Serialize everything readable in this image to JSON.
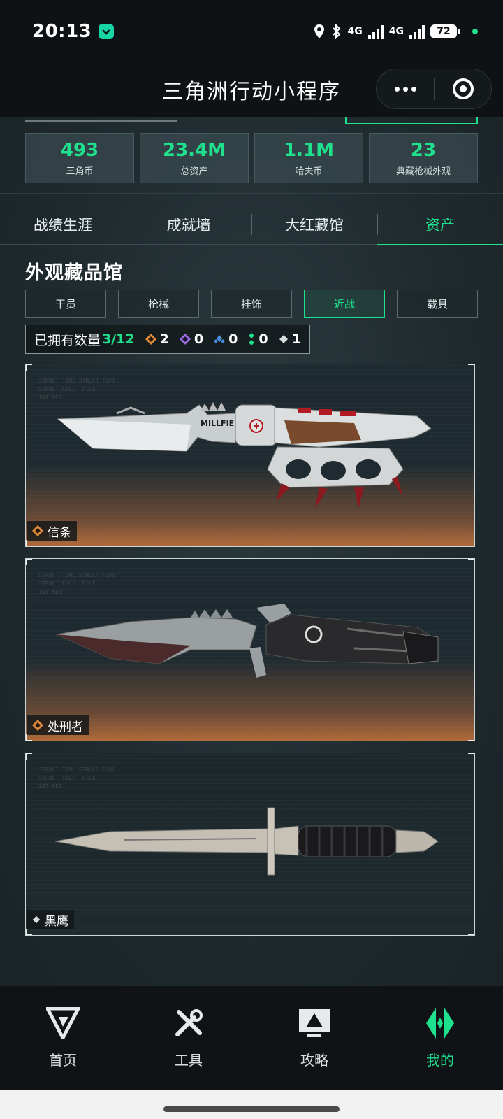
{
  "status_bar": {
    "time": "20:13",
    "network": "4G",
    "battery": "72"
  },
  "header": {
    "title": "三角洲行动小程序"
  },
  "stats": [
    {
      "value": "493",
      "label": "三角币"
    },
    {
      "value": "23.4M",
      "label": "总资产"
    },
    {
      "value": "1.1M",
      "label": "哈夫币"
    },
    {
      "value": "23",
      "label": "典藏枪械外观"
    }
  ],
  "tabs": [
    {
      "label": "战绩生涯",
      "active": false
    },
    {
      "label": "成就墙",
      "active": false
    },
    {
      "label": "大红藏馆",
      "active": false
    },
    {
      "label": "资产",
      "active": true
    }
  ],
  "section_title": "外观藏品馆",
  "categories": [
    {
      "label": "干员",
      "active": false
    },
    {
      "label": "枪械",
      "active": false
    },
    {
      "label": "挂饰",
      "active": false
    },
    {
      "label": "近战",
      "active": true
    },
    {
      "label": "载具",
      "active": false
    }
  ],
  "owned": {
    "label": "已拥有数量",
    "count": "3/12",
    "rarities": [
      {
        "color": "#e08a3c",
        "count": "2"
      },
      {
        "color": "#9a6ee0",
        "count": "0"
      },
      {
        "color": "#4a8ee0",
        "count": "0"
      },
      {
        "color": "#1ee08d",
        "count": "0"
      },
      {
        "color": "#d8dcdd",
        "count": "1"
      }
    ]
  },
  "items": [
    {
      "name": "信条",
      "rarity_color": "#e08a3c",
      "blade_mark": "MILLFIELD"
    },
    {
      "name": "处刑者",
      "rarity_color": "#e08a3c"
    },
    {
      "name": "黑鹰",
      "rarity_color": "#d8dcdd"
    }
  ],
  "tabbar": [
    {
      "label": "首页",
      "icon": "home-logo-icon",
      "active": false
    },
    {
      "label": "工具",
      "icon": "tools-icon",
      "active": false
    },
    {
      "label": "攻略",
      "icon": "guide-icon",
      "active": false
    },
    {
      "label": "我的",
      "icon": "profile-logo-icon",
      "active": true
    }
  ],
  "colors": {
    "accent": "#1ee08d",
    "gold": "#e08a3c",
    "background": "#1f2a2e"
  }
}
